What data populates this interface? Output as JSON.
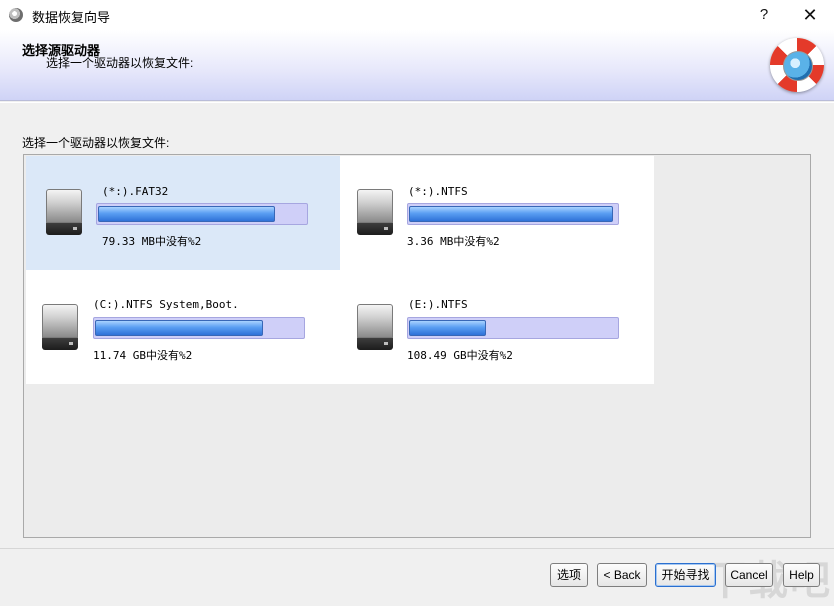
{
  "window": {
    "title": "数据恢复向导",
    "help_label": "?",
    "close_label": "✕"
  },
  "header": {
    "title": "选择源驱动器",
    "subtitle": "选择一个驱动器以恢复文件:"
  },
  "list_label": "选择一个驱动器以恢复文件:",
  "drives": [
    {
      "name": "(*:).FAT32",
      "info": "79.33 MB中没有%2",
      "used_fraction": 0.85,
      "selected": true
    },
    {
      "name": "(*:).NTFS",
      "info": "3.36 MB中没有%2",
      "used_fraction": 0.98,
      "selected": false
    },
    {
      "name": "(C:).NTFS System,Boot.",
      "info": "11.74 GB中没有%2",
      "used_fraction": 0.81,
      "selected": false
    },
    {
      "name": "(E:).NTFS",
      "info": "108.49 GB中没有%2",
      "used_fraction": 0.37,
      "selected": false
    }
  ],
  "buttons": {
    "options": "选项",
    "back": "< Back",
    "start": "开始寻找",
    "cancel": "Cancel",
    "help": "Help"
  },
  "watermark": "下载吧",
  "colors": {
    "selected_card": "#dbe8f8",
    "bar_track": "#cfcff8",
    "bar_fill": "#2f72d8"
  }
}
